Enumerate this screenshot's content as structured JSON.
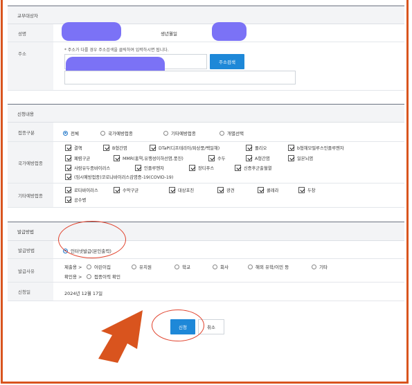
{
  "sections": {
    "recipient_title": "교부대상자",
    "application_title": "신청내용",
    "issuance_title": "발급방법"
  },
  "recipient": {
    "name_label": "성명",
    "birth_label": "생년월일",
    "address_label": "주소",
    "address_note": "* 주소가 다를 경우 주소검색을 클릭하여 입력하시면 됩니다.",
    "address_search_button": "주소검색"
  },
  "application": {
    "type_label": "접종구분",
    "type_options": [
      "전체",
      "국가예방접종",
      "기타예방접종",
      "개별선택"
    ],
    "type_selected": "전체",
    "national_label": "국가예방접종",
    "national_items": [
      "결핵",
      "B형간염",
      "DTaP(디프테리아/파상풍/백일해)",
      "폴리오",
      "b형헤모필루스인플루엔자",
      "폐렴구균",
      "MMR(홍역,유행성이하선염,풍진)",
      "수두",
      "A형간염",
      "일본뇌염",
      "사람유두종바이러스",
      "인플루엔자",
      "장티푸스",
      "신증후군출혈열",
      "(임시예방접종)코로나바이러스감염증-19(COVID-19)"
    ],
    "other_label": "기타예방접종",
    "other_items": [
      "로타바이러스",
      "수막구균",
      "대상포진",
      "광견",
      "콜레라",
      "두창",
      "공수병"
    ]
  },
  "issuance": {
    "method_label": "발급방법",
    "method_option": "인터넷발급(본인출력)",
    "reason_label": "발급사유",
    "reason_row1_prefix": "제출용 >",
    "reason_row1_options": [
      "어린이집",
      "유치원",
      "학교",
      "회사",
      "해외 유학/이민 등",
      "기타"
    ],
    "reason_row2_prefix": "확인용 >",
    "reason_row2_options": [
      "접종이력 확인"
    ],
    "date_label": "신청일",
    "date_value": "2024년 12월 17일"
  },
  "actions": {
    "apply_button": "신청",
    "cancel_button": "취소"
  },
  "colors": {
    "accent": "#1e88d8",
    "annotation": "#e0402a",
    "redaction": "#7b72f6",
    "frame": "#d9541e"
  }
}
